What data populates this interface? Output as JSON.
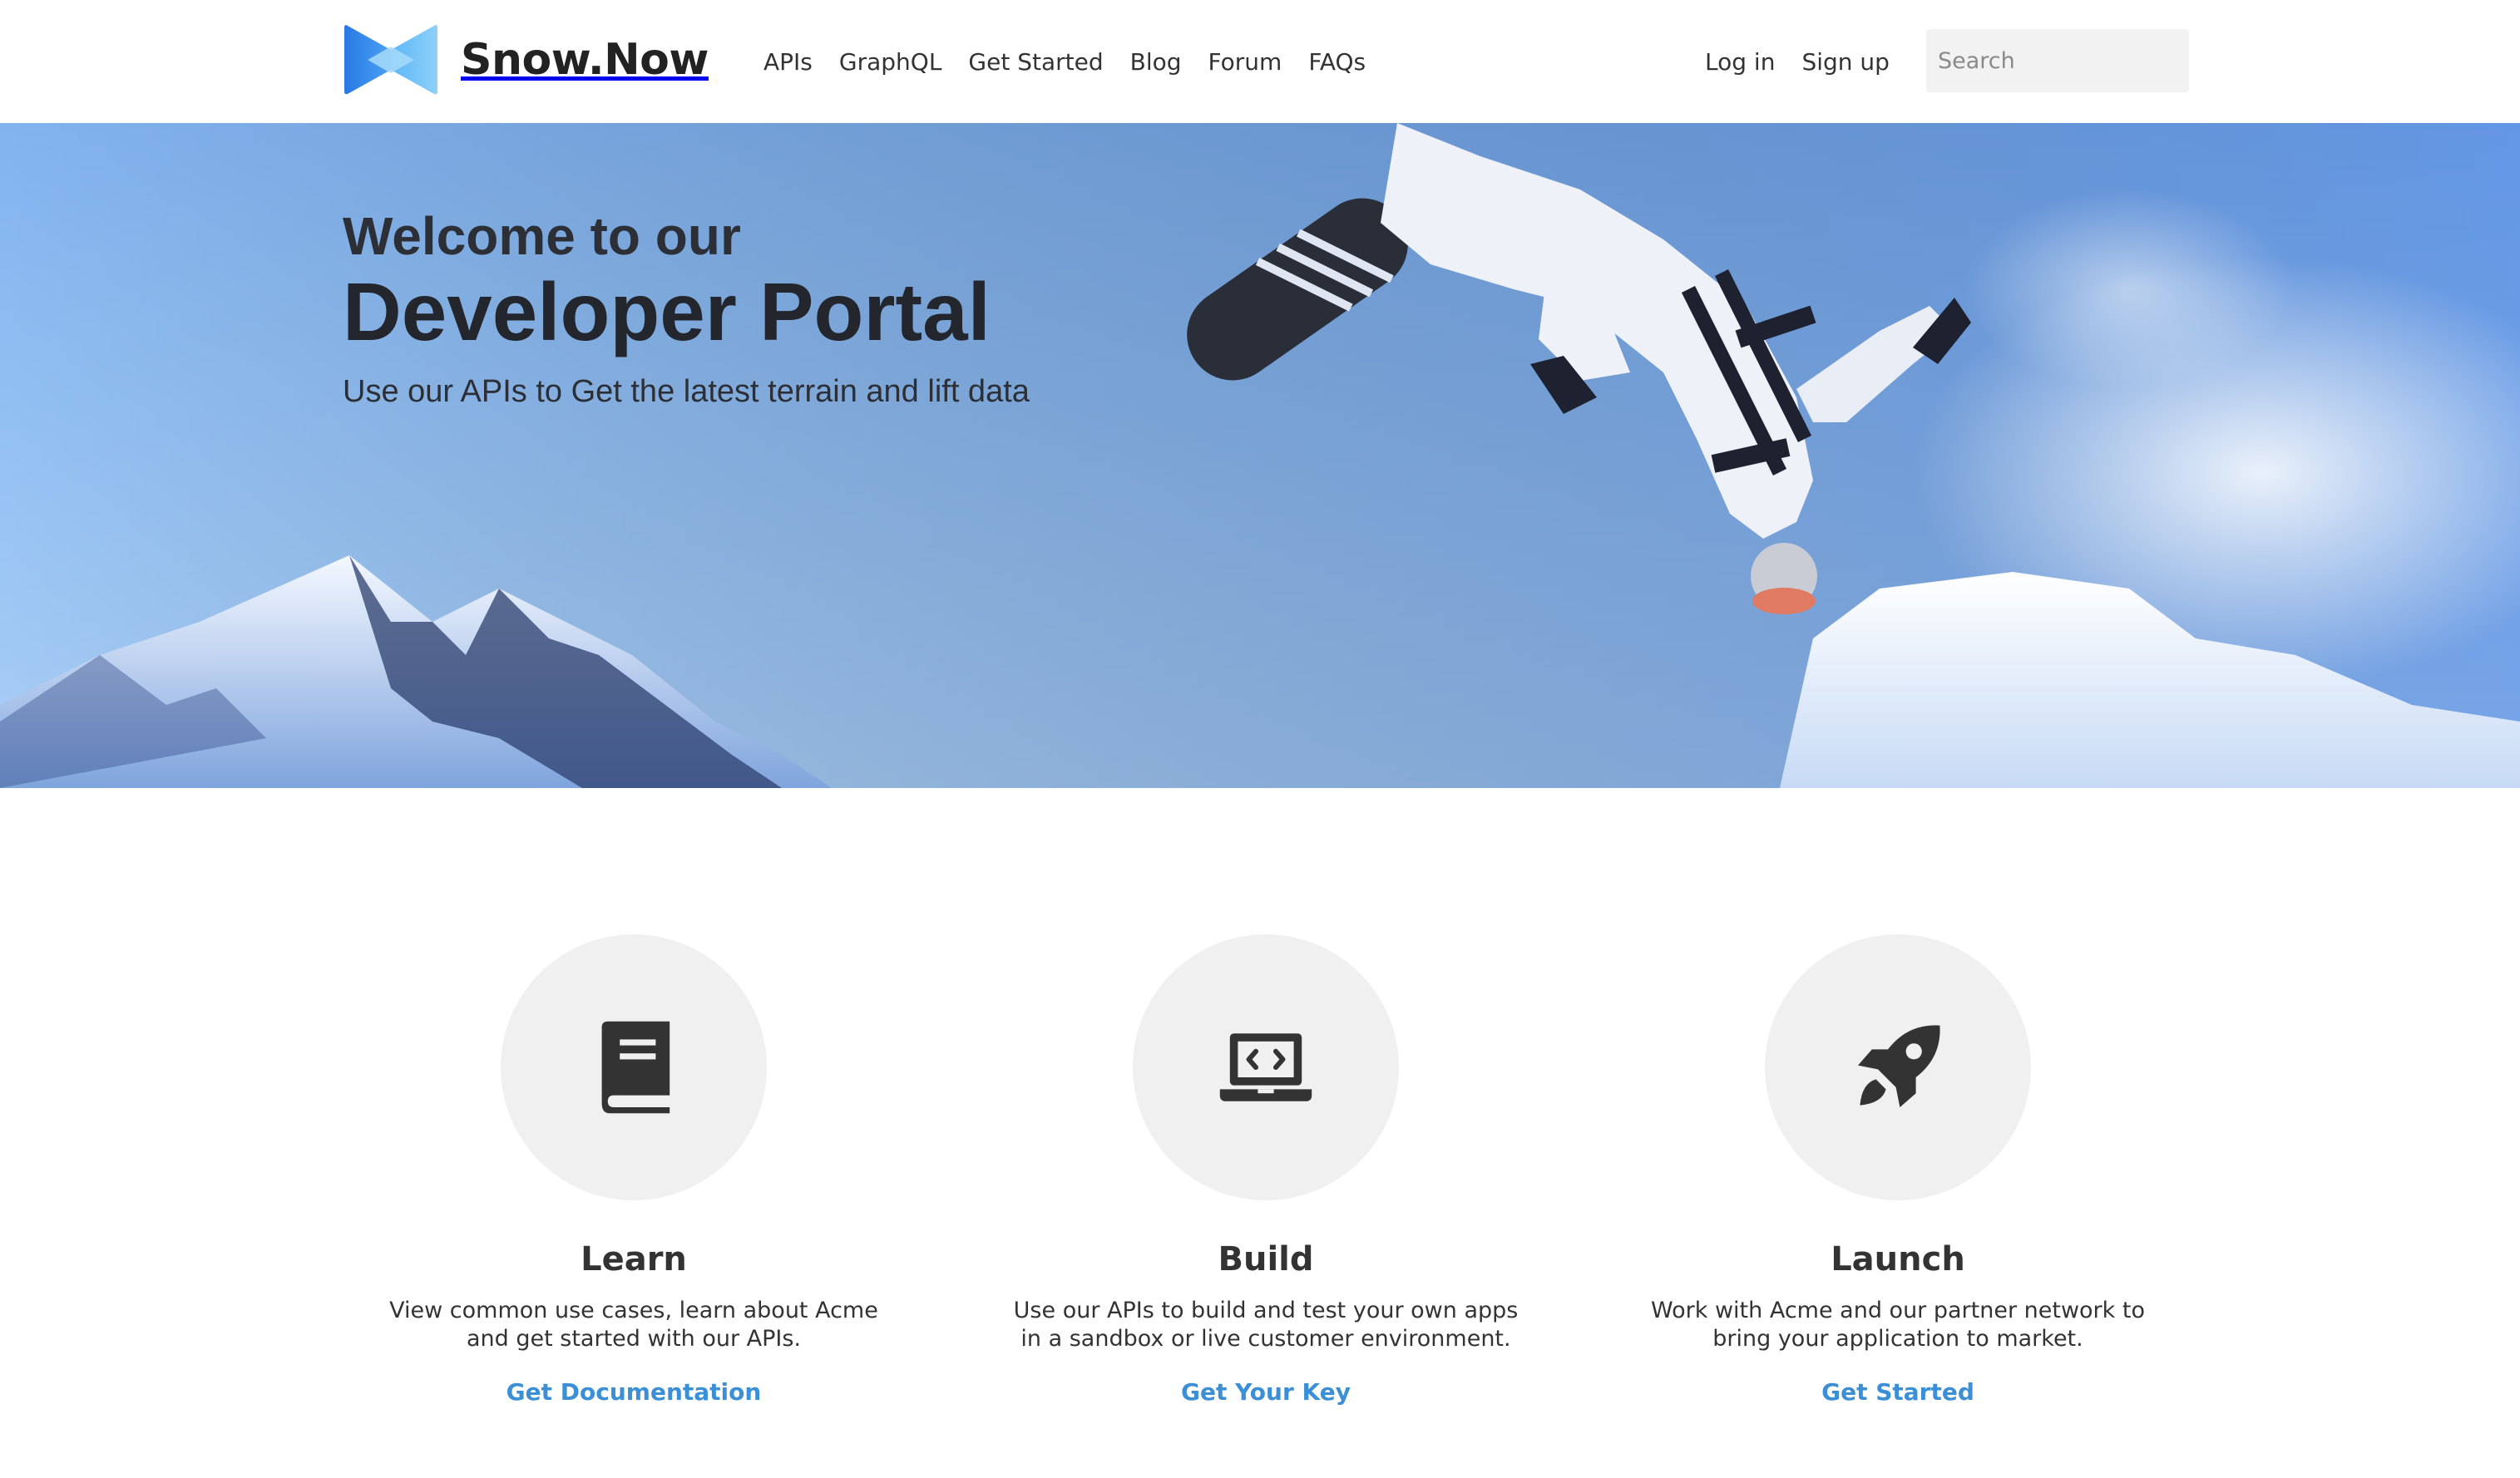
{
  "brand": {
    "name": "Snow.Now"
  },
  "nav": {
    "items": [
      "APIs",
      "GraphQL",
      "Get Started",
      "Blog",
      "Forum",
      "FAQs"
    ]
  },
  "auth": {
    "login": "Log in",
    "signup": "Sign up"
  },
  "search": {
    "placeholder": "Search"
  },
  "hero": {
    "welcome": "Welcome to our",
    "title": "Developer Portal",
    "subtitle": "Use our APIs to Get the latest terrain and lift data"
  },
  "features": [
    {
      "icon": "book-icon",
      "title": "Learn",
      "desc_line1": "View common use cases, learn about Acme",
      "desc_line2": "and get started with our APIs.",
      "link": "Get Documentation"
    },
    {
      "icon": "laptop-code-icon",
      "title": "Build",
      "desc_line1": "Use our APIs to build and test your own apps",
      "desc_line2": "in a sandbox or live customer environment.",
      "link": "Get Your Key"
    },
    {
      "icon": "rocket-icon",
      "title": "Launch",
      "desc_line1": "Work with Acme and our partner network to",
      "desc_line2": "bring your application to market.",
      "link": "Get Started"
    }
  ],
  "colors": {
    "accent_link": "#3b8fd6",
    "logo_blue": "#2f80ed",
    "logo_light": "#7cc3f7",
    "icon_circle": "#f0f0f0",
    "sky": "#93c0f3"
  }
}
